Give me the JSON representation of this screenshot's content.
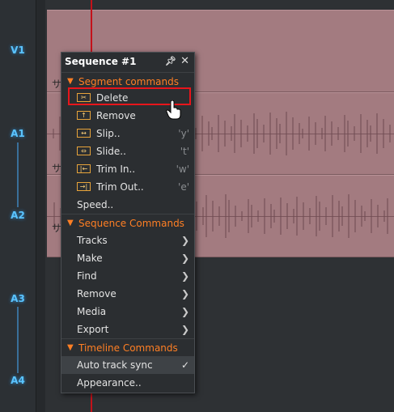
{
  "tracks": [
    "V1",
    "A1",
    "A2",
    "A3",
    "A4"
  ],
  "clip_tag": "サ",
  "menu": {
    "title": "Sequence #1",
    "segment": {
      "header": "Segment commands",
      "items": [
        {
          "label": "Delete",
          "key": ""
        },
        {
          "label": "Remove",
          "key": ""
        },
        {
          "label": "Slip..",
          "key": "'y'"
        },
        {
          "label": "Slide..",
          "key": "'t'"
        },
        {
          "label": "Trim In..",
          "key": "'w'"
        },
        {
          "label": "Trim Out..",
          "key": "'e'"
        },
        {
          "label": "Speed..",
          "key": ""
        }
      ]
    },
    "sequence": {
      "header": "Sequence Commands",
      "items": [
        "Tracks",
        "Make",
        "Find",
        "Remove",
        "Media",
        "Export"
      ]
    },
    "timeline": {
      "header": "Timeline Commands",
      "items": [
        {
          "label": "Auto track sync",
          "checked": true
        },
        {
          "label": "Appearance..",
          "checked": false
        }
      ]
    }
  },
  "colors": {
    "clip": "#a37b80",
    "track_label": "#5bc4ff",
    "section_header": "#ff7f24",
    "playhead": "#c4121a",
    "highlight": "#e8151b"
  },
  "icons": {
    "pin": "pin-icon",
    "close": "close-icon",
    "submenu": "chevron-right-icon",
    "collapse": "triangle-down-icon"
  }
}
